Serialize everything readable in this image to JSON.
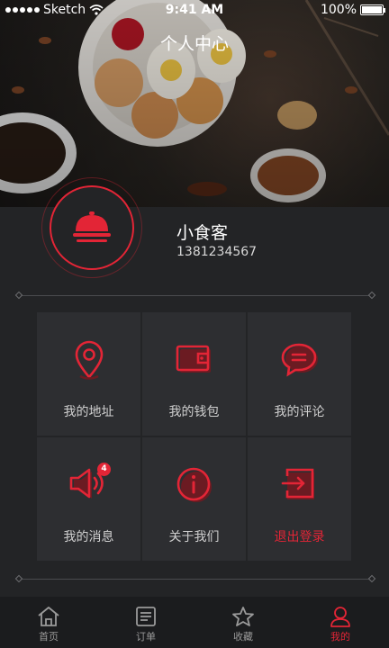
{
  "status_bar": {
    "carrier": "Sketch",
    "time": "9:41 AM",
    "battery": "100%"
  },
  "header": {
    "title": "个人中心"
  },
  "profile": {
    "name": "小食客",
    "phone": "1381234567"
  },
  "menu": [
    {
      "label": "我的地址",
      "icon": "location-pin-icon"
    },
    {
      "label": "我的钱包",
      "icon": "wallet-icon"
    },
    {
      "label": "我的评论",
      "icon": "comment-icon"
    },
    {
      "label": "我的消息",
      "icon": "speaker-icon",
      "badge": "4"
    },
    {
      "label": "关于我们",
      "icon": "info-icon"
    },
    {
      "label": "退出登录",
      "icon": "logout-icon"
    }
  ],
  "tabs": [
    {
      "label": "首页",
      "icon": "home-icon"
    },
    {
      "label": "订单",
      "icon": "order-icon"
    },
    {
      "label": "收藏",
      "icon": "star-icon"
    },
    {
      "label": "我的",
      "icon": "user-icon",
      "active": true
    }
  ],
  "colors": {
    "accent": "#e32536",
    "background": "#232426",
    "cell": "#2d2e31",
    "tabbar": "#1b1c1e"
  }
}
